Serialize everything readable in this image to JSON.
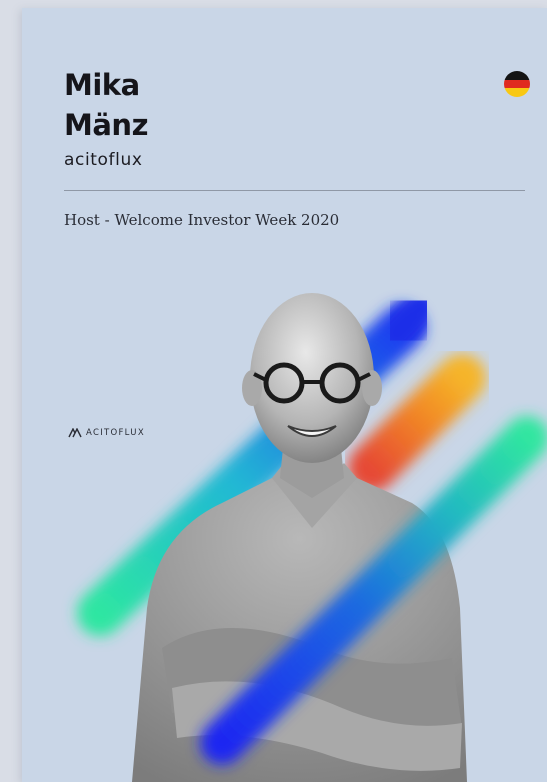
{
  "profile": {
    "first_name": "Mika",
    "last_name": "Mänz",
    "company": "acitoflux",
    "role": "Host - Welcome Investor Week 2020",
    "country_flag": "germany-flag-icon"
  },
  "logo": {
    "text": "ACITOFLUX"
  },
  "colors": {
    "background": "#c9d6e7",
    "stripe_blue": "#1f2ee8",
    "stripe_orange": "#f08a24",
    "stripe_green": "#2fe0a6",
    "stripe_cyan": "#1ab0d8"
  }
}
